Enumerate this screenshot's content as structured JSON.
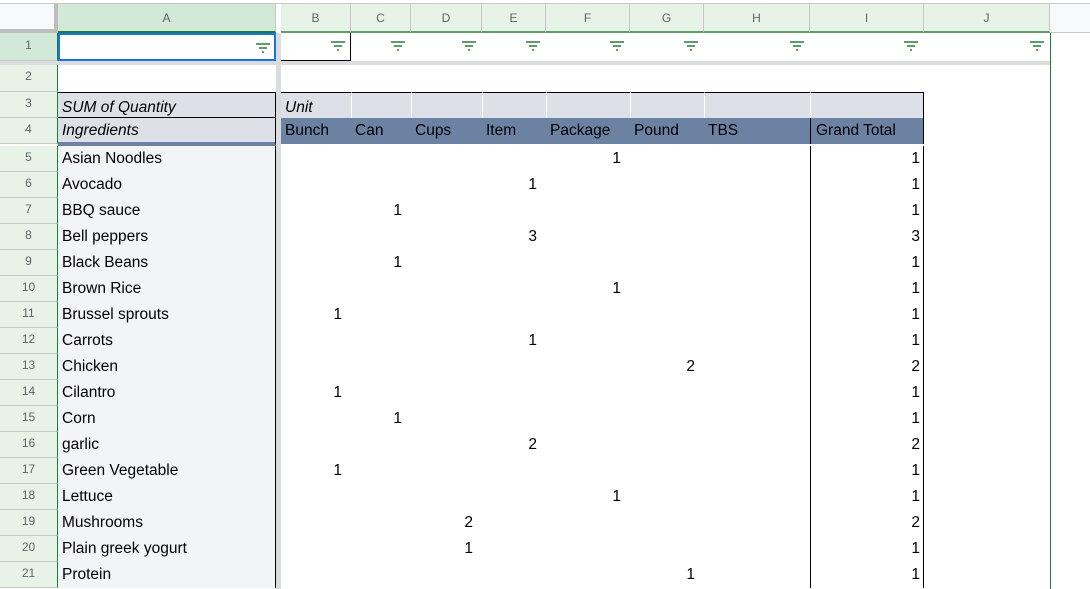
{
  "columns": [
    "A",
    "B",
    "C",
    "D",
    "E",
    "F",
    "G",
    "H",
    "I",
    "J"
  ],
  "row_numbers": [
    "1",
    "2",
    "3",
    "4",
    "5",
    "6",
    "7",
    "8",
    "9",
    "10",
    "11",
    "12",
    "13",
    "14",
    "15",
    "16",
    "17",
    "18",
    "19",
    "20",
    "21"
  ],
  "pivot": {
    "value_label": "SUM of Quantity",
    "row_field": "Ingredients",
    "column_field": "Unit",
    "unit_headers": [
      "Bunch",
      "Can",
      "Cups",
      "Item",
      "Package",
      "Pound",
      "TBS"
    ],
    "grand_total_label": "Grand Total",
    "rows": [
      {
        "ingredient": "Asian Noodles",
        "values": [
          "",
          "",
          "",
          "",
          "1",
          "",
          ""
        ],
        "total": "1"
      },
      {
        "ingredient": "Avocado",
        "values": [
          "",
          "",
          "",
          "1",
          "",
          "",
          ""
        ],
        "total": "1"
      },
      {
        "ingredient": "BBQ sauce",
        "values": [
          "",
          "1",
          "",
          "",
          "",
          "",
          ""
        ],
        "total": "1"
      },
      {
        "ingredient": "Bell peppers",
        "values": [
          "",
          "",
          "",
          "3",
          "",
          "",
          ""
        ],
        "total": "3"
      },
      {
        "ingredient": "Black Beans",
        "values": [
          "",
          "1",
          "",
          "",
          "",
          "",
          ""
        ],
        "total": "1"
      },
      {
        "ingredient": "Brown Rice",
        "values": [
          "",
          "",
          "",
          "",
          "1",
          "",
          ""
        ],
        "total": "1"
      },
      {
        "ingredient": "Brussel sprouts",
        "values": [
          "1",
          "",
          "",
          "",
          "",
          "",
          ""
        ],
        "total": "1"
      },
      {
        "ingredient": "Carrots",
        "values": [
          "",
          "",
          "",
          "1",
          "",
          "",
          ""
        ],
        "total": "1"
      },
      {
        "ingredient": "Chicken",
        "values": [
          "",
          "",
          "",
          "",
          "",
          "2",
          ""
        ],
        "total": "2"
      },
      {
        "ingredient": "Cilantro",
        "values": [
          "1",
          "",
          "",
          "",
          "",
          "",
          ""
        ],
        "total": "1"
      },
      {
        "ingredient": "Corn",
        "values": [
          "",
          "1",
          "",
          "",
          "",
          "",
          ""
        ],
        "total": "1"
      },
      {
        "ingredient": "garlic",
        "values": [
          "",
          "",
          "",
          "2",
          "",
          "",
          ""
        ],
        "total": "2"
      },
      {
        "ingredient": "Green Vegetable",
        "values": [
          "1",
          "",
          "",
          "",
          "",
          "",
          ""
        ],
        "total": "1"
      },
      {
        "ingredient": "Lettuce",
        "values": [
          "",
          "",
          "",
          "",
          "1",
          "",
          ""
        ],
        "total": "1"
      },
      {
        "ingredient": "Mushrooms",
        "values": [
          "",
          "",
          "2",
          "",
          "",
          "",
          ""
        ],
        "total": "2"
      },
      {
        "ingredient": "Plain greek yogurt",
        "values": [
          "",
          "",
          "1",
          "",
          "",
          "",
          ""
        ],
        "total": "1"
      },
      {
        "ingredient": "Protein",
        "values": [
          "",
          "",
          "",
          "",
          "",
          "1",
          ""
        ],
        "total": "1"
      }
    ]
  },
  "colors": {
    "pivot_header_dark": "#6c82a3",
    "pivot_header_light": "#dde1e7",
    "row_label_bg": "#f3f4f6",
    "selection": "#1a73e8",
    "filter_green": "#5f9e6a"
  }
}
